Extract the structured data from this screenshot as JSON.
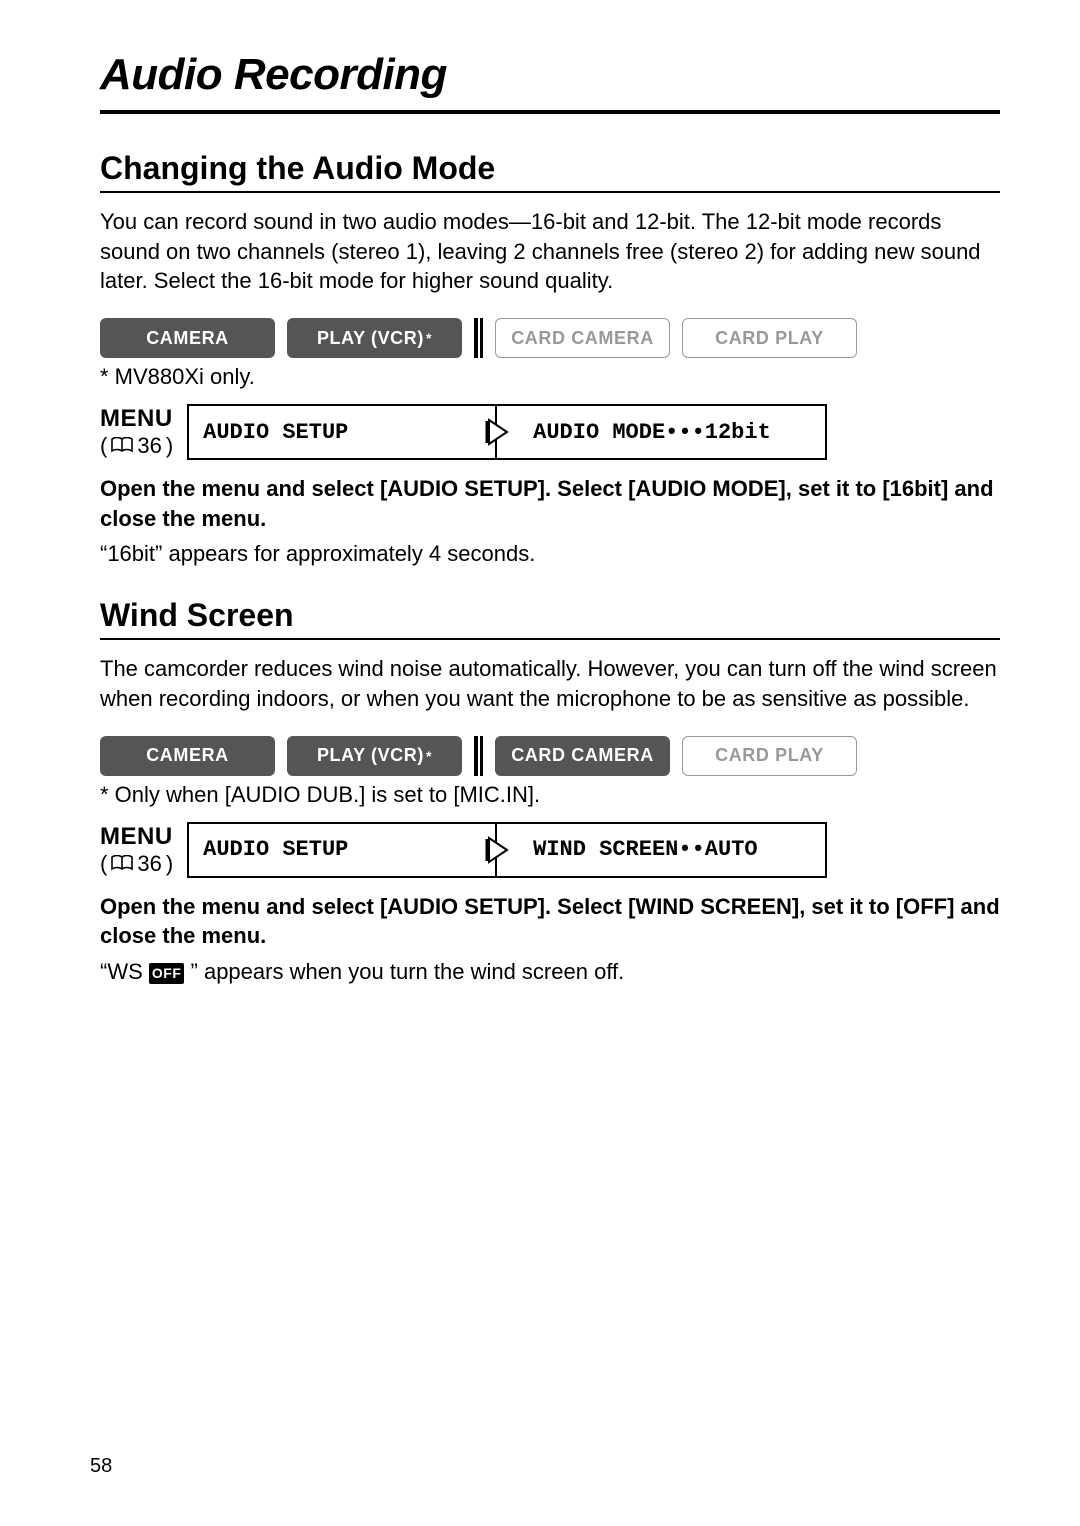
{
  "page_number": "58",
  "page_title": "Audio Recording",
  "sections": {
    "audio_mode": {
      "heading": "Changing the Audio Mode",
      "intro": "You can record sound in two audio modes—16-bit and 12-bit. The 12-bit mode records sound on two channels (stereo 1), leaving 2 channels free (stereo 2) for adding new sound later. Select the 16-bit mode for higher sound quality.",
      "modes": {
        "camera": "CAMERA",
        "play_vcr": "PLAY (VCR)",
        "card_camera": "CARD CAMERA",
        "card_play": "CARD PLAY"
      },
      "footnote": "* MV880Xi only.",
      "menu_word": "MENU",
      "menu_ref": "36",
      "menu_box1": "AUDIO SETUP",
      "menu_box2": "AUDIO MODE•••12bit",
      "instruction": "Open the menu and select [AUDIO SETUP]. Select [AUDIO MODE], set it to [16bit] and close the menu.",
      "note": "“16bit” appears for approximately 4 seconds."
    },
    "wind_screen": {
      "heading": "Wind Screen",
      "intro": "The camcorder reduces wind noise automatically. However, you can turn off the wind screen when recording indoors, or when you want the microphone to be as sensitive as possible.",
      "modes": {
        "camera": "CAMERA",
        "play_vcr": "PLAY (VCR)",
        "card_camera": "CARD CAMERA",
        "card_play": "CARD PLAY"
      },
      "footnote": "* Only when [AUDIO DUB.] is set to [MIC.IN].",
      "menu_word": "MENU",
      "menu_ref": "36",
      "menu_box1": "AUDIO SETUP",
      "menu_box2": "WIND SCREEN••AUTO",
      "instruction": "Open the menu and select [AUDIO SETUP]. Select [WIND SCREEN], set it to [OFF] and close the menu.",
      "note_prefix": "“WS",
      "off_badge": "OFF",
      "note_suffix": "” appears when you turn the wind screen off."
    }
  }
}
